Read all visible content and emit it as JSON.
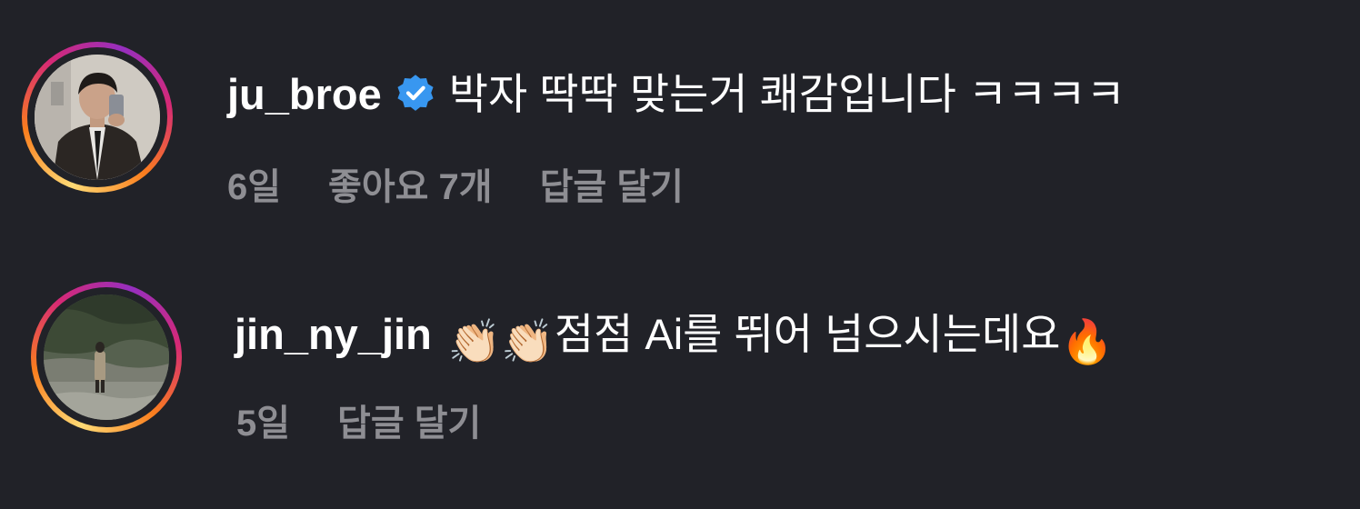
{
  "comments": [
    {
      "username": "ju_broe",
      "verified": true,
      "text": "박자 딱딱 맞는거 쾌감입니다 ㅋㅋㅋㅋ",
      "time": "6일",
      "likes": "좋아요 7개",
      "reply": "답글 달기",
      "avatar_icon": "profile-photo-man-in-suit"
    },
    {
      "username": "jin_ny_jin",
      "verified": false,
      "emoji_prefix": "👏🏻👏🏻",
      "text": "점점 Ai를 뛰어 넘으시는데요",
      "emoji_suffix": "🔥",
      "time": "5일",
      "reply": "답글 달기",
      "avatar_icon": "profile-photo-person-on-rocky-shore"
    }
  ],
  "colors": {
    "background": "#212228",
    "text": "#ffffff",
    "meta": "#8e8e93",
    "verified_badge": "#3897f0"
  }
}
